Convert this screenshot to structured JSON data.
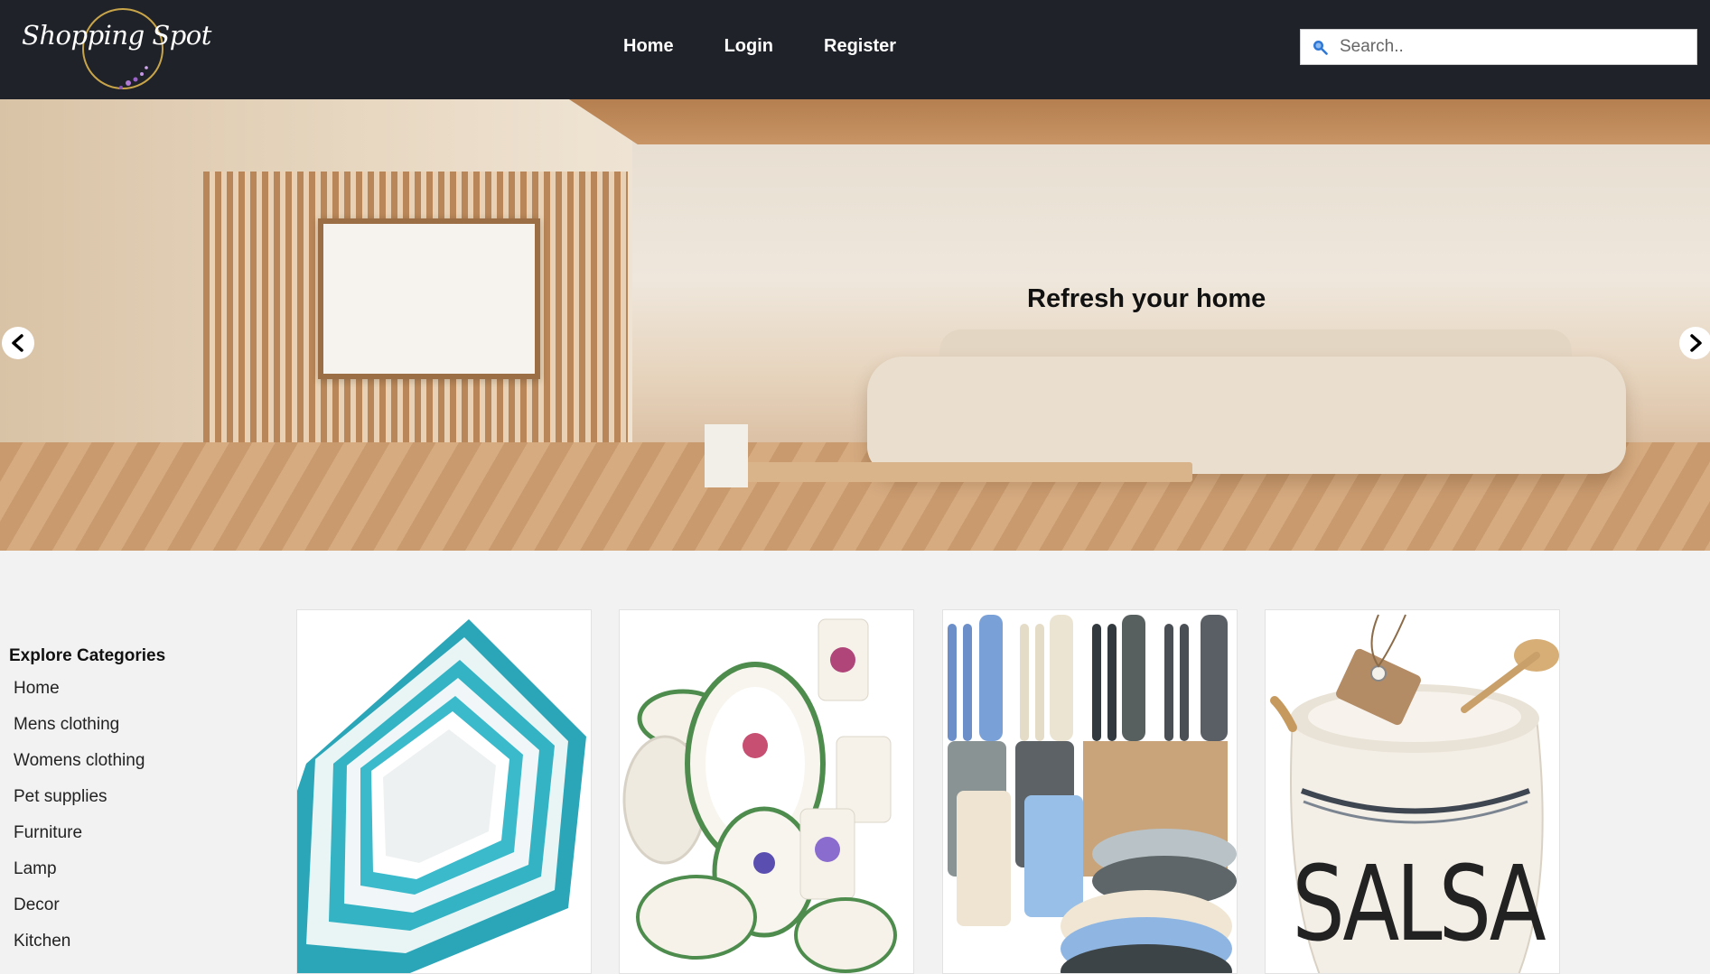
{
  "header": {
    "logo_text": "Shopping Spot",
    "nav": [
      {
        "label": "Home"
      },
      {
        "label": "Login"
      },
      {
        "label": "Register"
      }
    ],
    "search": {
      "placeholder": "Search.."
    }
  },
  "hero": {
    "title": "Refresh your home",
    "prev_icon": "chevron-left-icon",
    "next_icon": "chevron-right-icon"
  },
  "categories": {
    "title": "Explore Categories",
    "items": [
      {
        "label": "Home"
      },
      {
        "label": "Mens clothing"
      },
      {
        "label": "Womens clothing"
      },
      {
        "label": "Pet supplies"
      },
      {
        "label": "Furniture"
      },
      {
        "label": "Lamp"
      },
      {
        "label": "Decor"
      },
      {
        "label": "Kitchen"
      }
    ]
  },
  "products": {
    "salsa_label": "SALSA"
  },
  "colors": {
    "header_bg": "#1f2228",
    "page_bg": "#f2f2f2",
    "search_icon": "#2f78d6"
  }
}
